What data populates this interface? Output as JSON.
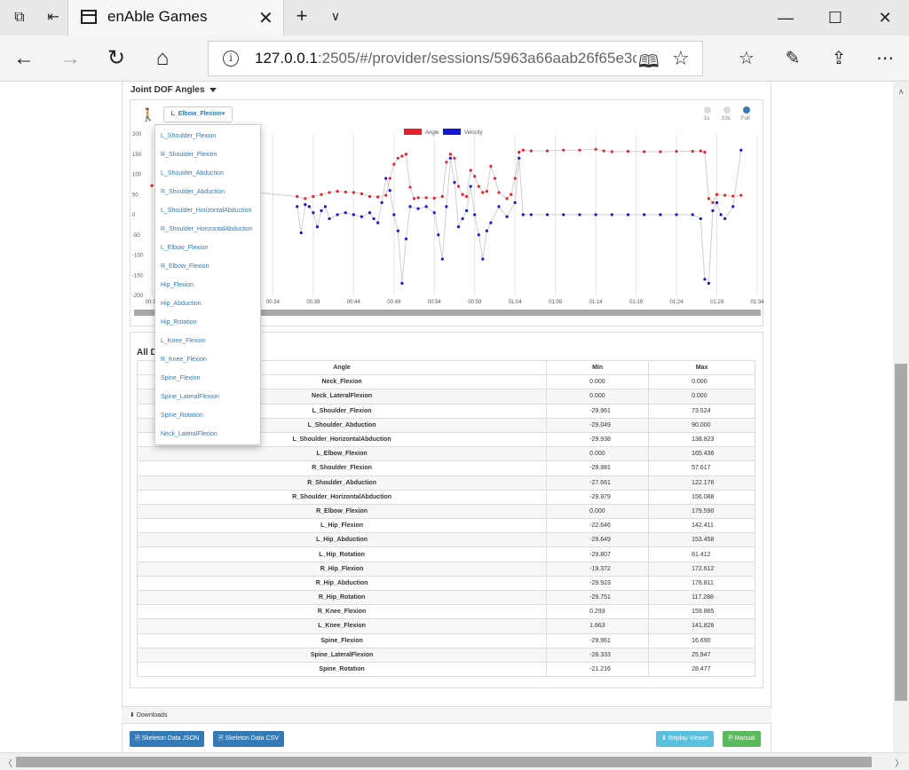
{
  "browser": {
    "tab_title": "enAble Games",
    "url_host": "127.0.0.1",
    "url_rest": ":2505/#/provider/sessions/5963a66aab26f65e3c8cb7"
  },
  "section": {
    "title": "Joint DOF Angles",
    "selected_joint": "L_Elbow_Flexion▾",
    "range_labels": [
      "1s",
      "10s",
      "Full"
    ]
  },
  "dropdown": {
    "items": [
      "L_Shoulder_Flexion",
      "R_Shoulder_Flexion",
      "L_Shoulder_Abduction",
      "R_Shoulder_Abduction",
      "L_Shoulder_HorizontalAbduction",
      "R_Shoulder_HorizontalAbduction",
      "L_Elbow_Flexion",
      "R_Elbow_Flexion",
      "Hip_Flexion",
      "Hip_Abduction",
      "Hip_Rotation",
      "L_Knee_Flexion",
      "R_Knee_Flexion",
      "Spine_Flexion",
      "Spine_LateralFlexion",
      "Spine_Rotation",
      "Neck_LateralFlexion"
    ]
  },
  "chart_data": {
    "type": "scatter",
    "legend": [
      "Angle",
      "Velocity"
    ],
    "legend_position": "top-center",
    "colors": {
      "Angle": "#e8212a",
      "Velocity": "#1515d6"
    },
    "ylim": [
      -200,
      200
    ],
    "yticks": [
      200,
      150,
      100,
      50,
      0,
      -50,
      -100,
      -150,
      -200
    ],
    "xticks": [
      "00:19",
      "",
      "",
      "00:34",
      "00:39",
      "00:44",
      "00:49",
      "00:54",
      "00:59",
      "01:04",
      "01:09",
      "01:14",
      "01:19",
      "01:24",
      "01:29",
      "01:34"
    ],
    "xlim_seconds": [
      19,
      94
    ],
    "grid": true,
    "series": [
      {
        "name": "Angle",
        "points": [
          [
            19,
            72
          ],
          [
            20,
            75
          ],
          [
            21,
            76
          ],
          [
            37,
            45
          ],
          [
            38,
            40
          ],
          [
            39,
            45
          ],
          [
            40,
            50
          ],
          [
            41,
            55
          ],
          [
            42,
            58
          ],
          [
            43,
            56
          ],
          [
            44,
            55
          ],
          [
            45,
            52
          ],
          [
            46,
            45
          ],
          [
            47,
            44
          ],
          [
            48,
            48
          ],
          [
            48.5,
            90
          ],
          [
            49,
            125
          ],
          [
            49.5,
            140
          ],
          [
            50,
            145
          ],
          [
            50.5,
            150
          ],
          [
            51,
            68
          ],
          [
            51.5,
            40
          ],
          [
            52,
            42
          ],
          [
            53,
            42
          ],
          [
            54,
            41
          ],
          [
            55,
            45
          ],
          [
            55.5,
            130
          ],
          [
            56,
            150
          ],
          [
            56.5,
            140
          ],
          [
            57,
            70
          ],
          [
            57.5,
            50
          ],
          [
            58,
            45
          ],
          [
            58.5,
            110
          ],
          [
            59,
            95
          ],
          [
            59.5,
            70
          ],
          [
            60,
            55
          ],
          [
            60.5,
            58
          ],
          [
            61,
            120
          ],
          [
            61.5,
            90
          ],
          [
            62,
            55
          ],
          [
            63,
            40
          ],
          [
            63.5,
            50
          ],
          [
            64,
            90
          ],
          [
            64.5,
            155
          ],
          [
            65,
            160
          ],
          [
            66,
            158
          ],
          [
            68,
            158
          ],
          [
            70,
            160
          ],
          [
            72,
            160
          ],
          [
            74,
            162
          ],
          [
            75,
            158
          ],
          [
            76,
            156
          ],
          [
            78,
            157
          ],
          [
            80,
            156
          ],
          [
            82,
            156
          ],
          [
            84,
            157
          ],
          [
            86,
            157
          ],
          [
            87,
            158
          ],
          [
            87.5,
            155
          ],
          [
            88,
            40
          ],
          [
            88.5,
            30
          ],
          [
            89,
            50
          ],
          [
            90,
            48
          ],
          [
            91,
            46
          ],
          [
            92,
            48
          ]
        ]
      },
      {
        "name": "Velocity",
        "points": [
          [
            37,
            20
          ],
          [
            37.5,
            -45
          ],
          [
            38,
            25
          ],
          [
            38.5,
            20
          ],
          [
            39,
            5
          ],
          [
            39.5,
            -30
          ],
          [
            40,
            10
          ],
          [
            40.5,
            20
          ],
          [
            41,
            -10
          ],
          [
            42,
            0
          ],
          [
            43,
            5
          ],
          [
            44,
            0
          ],
          [
            45,
            -5
          ],
          [
            46,
            5
          ],
          [
            46.5,
            -10
          ],
          [
            47,
            -20
          ],
          [
            47.5,
            30
          ],
          [
            48,
            90
          ],
          [
            48.5,
            60
          ],
          [
            49,
            0
          ],
          [
            49.5,
            -40
          ],
          [
            50,
            -170
          ],
          [
            50.5,
            -60
          ],
          [
            51,
            20
          ],
          [
            52,
            15
          ],
          [
            53,
            20
          ],
          [
            54,
            5
          ],
          [
            54.5,
            -50
          ],
          [
            55,
            -110
          ],
          [
            55.5,
            20
          ],
          [
            56,
            140
          ],
          [
            56.5,
            80
          ],
          [
            57,
            -30
          ],
          [
            57.5,
            -10
          ],
          [
            58,
            10
          ],
          [
            58.5,
            70
          ],
          [
            59,
            0
          ],
          [
            59.5,
            -50
          ],
          [
            60,
            -110
          ],
          [
            60.5,
            -40
          ],
          [
            61,
            -20
          ],
          [
            62,
            20
          ],
          [
            63,
            -5
          ],
          [
            64,
            30
          ],
          [
            64.5,
            140
          ],
          [
            65,
            0
          ],
          [
            66,
            0
          ],
          [
            68,
            0
          ],
          [
            70,
            0
          ],
          [
            72,
            0
          ],
          [
            74,
            0
          ],
          [
            76,
            0
          ],
          [
            78,
            0
          ],
          [
            80,
            0
          ],
          [
            82,
            0
          ],
          [
            84,
            0
          ],
          [
            86,
            0
          ],
          [
            87,
            -10
          ],
          [
            87.5,
            -160
          ],
          [
            88,
            -170
          ],
          [
            88.5,
            10
          ],
          [
            89,
            30
          ],
          [
            89.5,
            0
          ],
          [
            90,
            -10
          ],
          [
            91,
            20
          ],
          [
            92,
            160
          ]
        ]
      }
    ]
  },
  "table": {
    "title": "All D",
    "headers": [
      "Angle",
      "Min",
      "Max"
    ],
    "rows": [
      [
        "Neck_Flexion",
        "0.000",
        "0.000"
      ],
      [
        "Neck_LateralFlexion",
        "0.000",
        "0.000"
      ],
      [
        "L_Shoulder_Flexion",
        "-29.961",
        "73.524"
      ],
      [
        "L_Shoulder_Abduction",
        "-29.049",
        "90.000"
      ],
      [
        "L_Shoulder_HorizontalAbduction",
        "-29.938",
        "138.823"
      ],
      [
        "L_Elbow_Flexion",
        "0.000",
        "165.436"
      ],
      [
        "R_Shoulder_Flexion",
        "-29.981",
        "57.617"
      ],
      [
        "R_Shoulder_Abduction",
        "-27.661",
        "122.176"
      ],
      [
        "R_Shoulder_HorizontalAbduction",
        "-29.979",
        "156.088"
      ],
      [
        "R_Elbow_Flexion",
        "0.000",
        "179.590"
      ],
      [
        "L_Hip_Flexion",
        "-22.646",
        "142.411"
      ],
      [
        "L_Hip_Abduction",
        "-29.649",
        "153.458"
      ],
      [
        "L_Hip_Rotation",
        "-29.807",
        "61.412"
      ],
      [
        "R_Hip_Flexion",
        "-19.372",
        "172.612"
      ],
      [
        "R_Hip_Abduction",
        "-29.923",
        "176.811"
      ],
      [
        "R_Hip_Rotation",
        "-29.751",
        "117.288"
      ],
      [
        "R_Knee_Flexion",
        "0.293",
        "159.865"
      ],
      [
        "L_Knee_Flexion",
        "1.663",
        "141.826"
      ],
      [
        "Spine_Flexion",
        "-29.961",
        "16.690"
      ],
      [
        "Spine_LateralFlexion",
        "-28.333",
        "25.947"
      ],
      [
        "Spine_Rotation",
        "-21.216",
        "28.477"
      ]
    ]
  },
  "downloads": {
    "label": "Downloads",
    "buttons": {
      "skeleton_json": "Skeleton Data JSON",
      "skeleton_csv": "Skeleton Data CSV",
      "replay_viewer": "Replay Viewer",
      "manual": "Manual"
    }
  },
  "icons": {
    "tab_list": "tab-list-icon",
    "tabs_aside": "tabs-aside-icon",
    "back": "back-arrow-icon",
    "forward": "forward-arrow-icon",
    "refresh": "refresh-icon",
    "home": "home-icon",
    "reading": "reading-view-icon",
    "favorite": "star-icon",
    "favorites_hub": "favorites-hub-icon",
    "notes": "pen-icon",
    "share": "share-icon",
    "more": "more-icon",
    "person": "person-icon"
  }
}
